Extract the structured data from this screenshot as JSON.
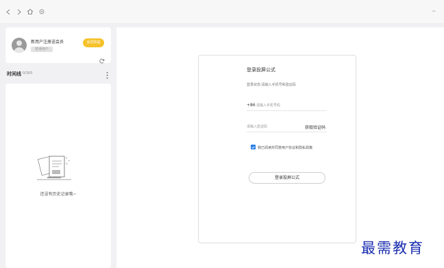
{
  "nav": {
    "back_icon": "chevron-left-icon",
    "forward_icon": "chevron-right-icon",
    "home_icon": "home-icon",
    "settings_icon": "gear-icon",
    "window_control": "–"
  },
  "profile": {
    "avatar_icon": "user-avatar-icon",
    "promo_title": "新用户注册送会员",
    "pill_label": "普通用户",
    "badge_label": "会员权益",
    "badge_color": "#f5c22a"
  },
  "timeline": {
    "title": "时间线",
    "subtitle": "0/300",
    "menu_icon": "kebab-menu-icon",
    "empty_text": "还没有历史记录哦~"
  },
  "login": {
    "title": "登录投屏公式",
    "status": "登录状态:请输入手机号和验证码",
    "phone_prefix": "+86",
    "phone_placeholder": "请输入手机号码",
    "code_placeholder": "请输入验证码",
    "get_code_label": "获取验证码",
    "agree_text": "我已阅读并同意用户协议和隐私政策",
    "agree_checked": true,
    "submit_label": "登录投屏公式",
    "accent_color": "#2a7fe6"
  },
  "watermark": {
    "text": "最需教育"
  }
}
